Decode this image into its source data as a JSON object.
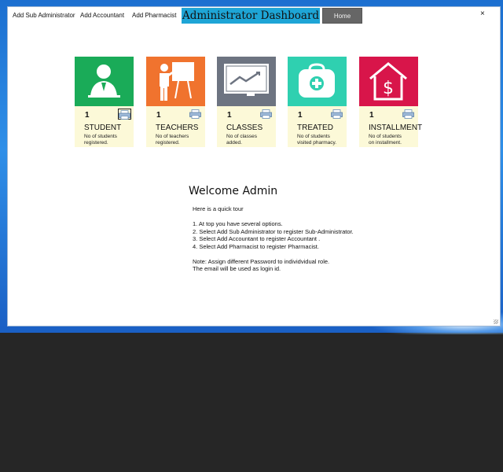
{
  "menu": {
    "add_sub_admin": "Add Sub Administrator",
    "add_accountant": "Add Accountant",
    "add_pharmacist": "Add Pharmacist",
    "title": "Administrator Dashboard",
    "home": "Home",
    "close": "×"
  },
  "cards": [
    {
      "count": "1",
      "label": "STUDENT",
      "desc1": "No of students",
      "desc2": "registered.",
      "color": "#1aab58",
      "icon": "student-icon"
    },
    {
      "count": "1",
      "label": "TEACHERS",
      "desc1": "No of teachers",
      "desc2": "registered.",
      "color": "#f0732e",
      "icon": "teacher-icon"
    },
    {
      "count": "1",
      "label": "CLASSES",
      "desc1": "No of classes",
      "desc2": "added.",
      "color": "#6d7481",
      "icon": "chart-board-icon"
    },
    {
      "count": "1",
      "label": "TREATED",
      "desc1": "No of students",
      "desc2": "visited pharmacy.",
      "color": "#2fd0b0",
      "icon": "medical-bag-icon"
    },
    {
      "count": "1",
      "label": "INSTALLMENT",
      "desc1": "No of students",
      "desc2": "on installment.",
      "color": "#d8154a",
      "icon": "dollar-house-icon"
    }
  ],
  "welcome": {
    "heading": "Welcome Admin",
    "intro": "Here is a quick tour",
    "lines": [
      "1. At top you have several options.",
      "2. Select Add Sub Administrator to register Sub-Administrator.",
      "3. Select Add Accountant to register Accountant .",
      "4. Select Add Pharmacist to register Pharmacist."
    ],
    "note1": "Note: Assign different Password to individvidual role.",
    "note2": "The email will be used as login id."
  }
}
